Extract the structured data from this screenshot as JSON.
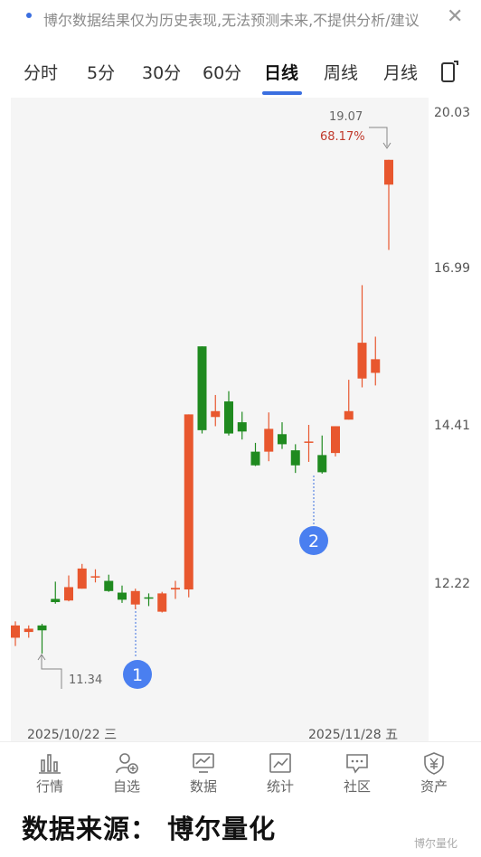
{
  "notice": {
    "text": "博尔数据结果仅为历史表现,无法预测未来,不提供分析/建议",
    "close_label": "✕"
  },
  "tabs": [
    {
      "label": "分时"
    },
    {
      "label": "5分"
    },
    {
      "label": "30分"
    },
    {
      "label": "60分"
    },
    {
      "label": "日线"
    },
    {
      "label": "周线"
    },
    {
      "label": "月线"
    }
  ],
  "active_tab": "日线",
  "chart": {
    "y_axis_labels": [
      "20.03",
      "16.99",
      "14.41",
      "12.22"
    ],
    "high_marker": {
      "price": "19.07",
      "pct": "68.17%"
    },
    "low_marker": {
      "price": "11.34"
    },
    "annotations": [
      "1",
      "2"
    ],
    "start_date": "2025/10/22 三",
    "end_date": "2025/11/28 五"
  },
  "chart_data": {
    "type": "candlestick",
    "up_color": "#e8572e",
    "down_color": "#1f8a1f",
    "candles": [
      {
        "open": 11.55,
        "close": 11.7,
        "high": 11.75,
        "low": 11.45
      },
      {
        "open": 11.62,
        "close": 11.66,
        "high": 11.7,
        "low": 11.55
      },
      {
        "open": 11.7,
        "close": 11.64,
        "high": 11.72,
        "low": 11.36
      },
      {
        "open": 12.03,
        "close": 11.99,
        "high": 12.25,
        "low": 11.97
      },
      {
        "open": 12.01,
        "close": 12.18,
        "high": 12.33,
        "low": 12.0
      },
      {
        "open": 12.16,
        "close": 12.42,
        "high": 12.48,
        "low": 12.16
      },
      {
        "open": 12.32,
        "close": 12.32,
        "high": 12.41,
        "low": 12.24
      },
      {
        "open": 12.26,
        "close": 12.13,
        "high": 12.34,
        "low": 12.12
      },
      {
        "open": 12.11,
        "close": 12.02,
        "high": 12.2,
        "low": 11.98
      },
      {
        "open": 11.96,
        "close": 12.13,
        "high": 12.16,
        "low": 11.9
      },
      {
        "open": 12.05,
        "close": 12.04,
        "high": 12.1,
        "low": 11.94
      },
      {
        "open": 11.87,
        "close": 12.1,
        "high": 12.12,
        "low": 11.86
      },
      {
        "open": 12.15,
        "close": 12.17,
        "high": 12.26,
        "low": 12.03
      },
      {
        "open": 12.15,
        "close": 14.6,
        "high": 14.6,
        "low": 12.05
      },
      {
        "open": 15.68,
        "close": 14.36,
        "high": 15.68,
        "low": 14.31
      },
      {
        "open": 14.56,
        "close": 14.65,
        "high": 14.9,
        "low": 14.42
      },
      {
        "open": 14.8,
        "close": 14.31,
        "high": 14.96,
        "low": 14.28
      },
      {
        "open": 14.48,
        "close": 14.34,
        "high": 14.64,
        "low": 14.22
      },
      {
        "open": 14.04,
        "close": 13.84,
        "high": 14.17,
        "low": 13.83
      },
      {
        "open": 14.04,
        "close": 14.38,
        "high": 14.63,
        "low": 13.9
      },
      {
        "open": 14.3,
        "close": 14.15,
        "high": 14.48,
        "low": 14.08
      },
      {
        "open": 14.06,
        "close": 13.84,
        "high": 14.15,
        "low": 13.73
      },
      {
        "open": 14.17,
        "close": 14.19,
        "high": 14.44,
        "low": 13.89
      },
      {
        "open": 13.99,
        "close": 13.74,
        "high": 14.28,
        "low": 13.72
      },
      {
        "open": 14.02,
        "close": 14.42,
        "high": 14.42,
        "low": 13.97
      },
      {
        "open": 14.52,
        "close": 14.65,
        "high": 15.14,
        "low": 14.52
      },
      {
        "open": 15.16,
        "close": 15.74,
        "high": 16.72,
        "low": 15.02
      },
      {
        "open": 15.25,
        "close": 15.47,
        "high": 15.84,
        "low": 15.05
      },
      {
        "open": 18.58,
        "close": 19.07,
        "high": 19.07,
        "low": 17.35
      }
    ]
  },
  "bottom_nav": [
    {
      "label": "行情",
      "icon": "bar-chart-icon"
    },
    {
      "label": "自选",
      "icon": "user-add-icon"
    },
    {
      "label": "数据",
      "icon": "monitor-chart-icon"
    },
    {
      "label": "统计",
      "icon": "trend-chart-icon"
    },
    {
      "label": "社区",
      "icon": "chat-bubble-icon"
    },
    {
      "label": "资产",
      "icon": "shield-yen-icon"
    }
  ],
  "footer": {
    "text": "数据来源： 博尔量化"
  },
  "watermark": {
    "text": "博尔量化"
  }
}
